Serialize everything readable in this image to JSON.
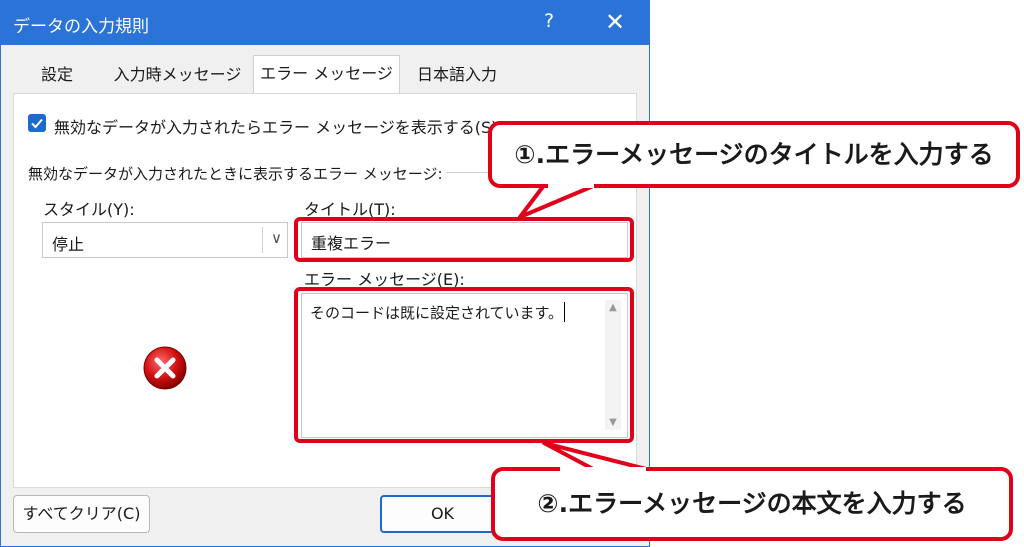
{
  "window": {
    "title": "データの入力規則",
    "help": "?",
    "close": "✕"
  },
  "tabs": [
    {
      "label": "設定",
      "active": false
    },
    {
      "label": "入力時メッセージ",
      "active": false
    },
    {
      "label": "エラー メッセージ",
      "active": true
    },
    {
      "label": "日本語入力",
      "active": false
    }
  ],
  "show_error_checkbox": {
    "label": "無効なデータが入力されたらエラー メッセージを表示する(S)",
    "checked": true
  },
  "group_label": "無効なデータが入力されたときに表示するエラー メッセージ:",
  "style": {
    "label": "スタイル(Y):",
    "value": "停止",
    "icon": "error-x-icon"
  },
  "title_field": {
    "label": "タイトル(T):",
    "value": "重複エラー"
  },
  "message_field": {
    "label": "エラー メッセージ(E):",
    "value": "そのコードは既に設定されています。"
  },
  "buttons": {
    "clear_all": "すべてクリア(C)",
    "ok": "OK"
  },
  "annotations": {
    "callout1": "①.エラーメッセージのタイトルを入力する",
    "callout2": "②.エラーメッセージの本文を入力する",
    "highlight_color": "#e0001a"
  },
  "colors": {
    "accent": "#2b73d6",
    "checkbox": "#1c6ad0"
  }
}
